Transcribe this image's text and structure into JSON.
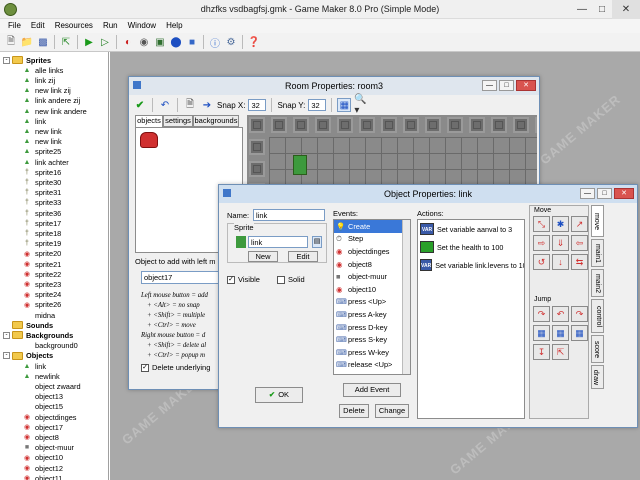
{
  "app": {
    "title": "dhzfks vsdbagfsj.gmk - Game Maker 8.0 Pro (Simple Mode)",
    "menu": [
      "File",
      "Edit",
      "Resources",
      "Run",
      "Window",
      "Help"
    ]
  },
  "tree": {
    "rows": [
      {
        "label": "Sprites",
        "type": "folder",
        "bold": true,
        "depth": 0,
        "exp": "-"
      },
      {
        "label": "alle links",
        "type": "res",
        "icon": "link",
        "depth": 1
      },
      {
        "label": "link zij",
        "type": "res",
        "icon": "link",
        "depth": 1
      },
      {
        "label": "new link zij",
        "type": "res",
        "icon": "link",
        "depth": 1
      },
      {
        "label": "link andere zij",
        "type": "res",
        "icon": "link",
        "depth": 1
      },
      {
        "label": "new link andere",
        "type": "res",
        "icon": "link",
        "depth": 1
      },
      {
        "label": "link",
        "type": "res",
        "icon": "link",
        "depth": 1
      },
      {
        "label": "new link",
        "type": "res",
        "icon": "link",
        "depth": 1
      },
      {
        "label": "new link",
        "type": "res",
        "icon": "link",
        "depth": 1
      },
      {
        "label": "sprite25",
        "type": "res",
        "icon": "link",
        "depth": 1
      },
      {
        "label": "link achter",
        "type": "res",
        "icon": "link",
        "depth": 1
      },
      {
        "label": "sprite16",
        "type": "res",
        "icon": "sword",
        "depth": 1
      },
      {
        "label": "sprite30",
        "type": "res",
        "icon": "sword",
        "depth": 1
      },
      {
        "label": "sprite31",
        "type": "res",
        "icon": "sword",
        "depth": 1
      },
      {
        "label": "sprite33",
        "type": "res",
        "icon": "sword",
        "depth": 1
      },
      {
        "label": "sprite36",
        "type": "res",
        "icon": "sword",
        "depth": 1
      },
      {
        "label": "sprite17",
        "type": "res",
        "icon": "sword",
        "depth": 1
      },
      {
        "label": "sprite18",
        "type": "res",
        "icon": "sword",
        "depth": 1
      },
      {
        "label": "sprite19",
        "type": "res",
        "icon": "sword",
        "depth": 1
      },
      {
        "label": "sprite20",
        "type": "res",
        "icon": "crab",
        "depth": 1
      },
      {
        "label": "sprite21",
        "type": "res",
        "icon": "crab",
        "depth": 1
      },
      {
        "label": "sprite22",
        "type": "res",
        "icon": "crab",
        "depth": 1
      },
      {
        "label": "sprite23",
        "type": "res",
        "icon": "crab",
        "depth": 1
      },
      {
        "label": "sprite24",
        "type": "res",
        "icon": "crab",
        "depth": 1
      },
      {
        "label": "sprite26",
        "type": "res",
        "icon": "crab",
        "depth": 1
      },
      {
        "label": "midna",
        "type": "res",
        "icon": "none",
        "depth": 1
      },
      {
        "label": "Sounds",
        "type": "folder",
        "bold": true,
        "depth": 0,
        "exp": ""
      },
      {
        "label": "Backgrounds",
        "type": "folder",
        "bold": true,
        "depth": 0,
        "exp": "-"
      },
      {
        "label": "background0",
        "type": "res",
        "icon": "none",
        "depth": 1
      },
      {
        "label": "Objects",
        "type": "folder",
        "bold": true,
        "depth": 0,
        "exp": "-"
      },
      {
        "label": "link",
        "type": "res",
        "icon": "link",
        "depth": 1
      },
      {
        "label": "newlink",
        "type": "res",
        "icon": "link",
        "depth": 1
      },
      {
        "label": "object zwaard",
        "type": "res",
        "icon": "none",
        "depth": 1
      },
      {
        "label": "object13",
        "type": "res",
        "icon": "none",
        "depth": 1
      },
      {
        "label": "object15",
        "type": "res",
        "icon": "none",
        "depth": 1
      },
      {
        "label": "objectdinges",
        "type": "res",
        "icon": "crab",
        "depth": 1
      },
      {
        "label": "object17",
        "type": "res",
        "icon": "crab",
        "depth": 1
      },
      {
        "label": "object8",
        "type": "res",
        "icon": "crab",
        "depth": 1
      },
      {
        "label": "object-muur",
        "type": "res",
        "icon": "wall",
        "depth": 1
      },
      {
        "label": "object10",
        "type": "res",
        "icon": "crab",
        "depth": 1
      },
      {
        "label": "object12",
        "type": "res",
        "icon": "crab",
        "depth": 1
      },
      {
        "label": "object11",
        "type": "res",
        "icon": "crab",
        "depth": 1
      }
    ]
  },
  "room": {
    "title": "Room Properties: room3",
    "snap_x_label": "Snap X:",
    "snap_x": "32",
    "snap_y_label": "Snap Y:",
    "snap_y": "32",
    "tabs": [
      "objects",
      "settings",
      "backgrounds"
    ],
    "add_label": "Object to add with left m",
    "selected_object": "object17",
    "help_lines": [
      "Left mouse button = add",
      "+ <Alt> = no snap",
      "+ <Shift> = multiple",
      "+ <Ctrl> = move",
      "Right mouse button = d",
      "+ <Shift> = delete al",
      "+ <Ctrl> = popup m"
    ],
    "delete_underlying": "Delete underlying"
  },
  "object": {
    "title": "Object Properties: link",
    "name_label": "Name:",
    "name_value": "link",
    "sprite_label": "Sprite",
    "sprite_value": "link",
    "new_label": "New",
    "edit_label": "Edit",
    "visible_label": "Visible",
    "solid_label": "Solid",
    "ok_label": "OK",
    "events_label": "Events:",
    "events": [
      "Create",
      "Step",
      "objectdinges",
      "object8",
      "object-muur",
      "object10",
      "press <Up>",
      "press A-key",
      "press D-key",
      "press S-key",
      "press W-key",
      "release <Up>"
    ],
    "add_event": "Add Event",
    "delete_label": "Delete",
    "change_label": "Change",
    "actions_label": "Actions:",
    "actions": [
      {
        "icon": "VAR",
        "text": "Set variable aanval to 3"
      },
      {
        "icon": "HP",
        "text": "Set the health to 100"
      },
      {
        "icon": "VAR",
        "text": "Set variable link.levens to 10"
      }
    ],
    "side_tabs": [
      "move",
      "main1",
      "main2",
      "control",
      "score",
      "draw"
    ],
    "move_label": "Move",
    "jump_label": "Jump"
  },
  "watermark": "GAME MAKER"
}
